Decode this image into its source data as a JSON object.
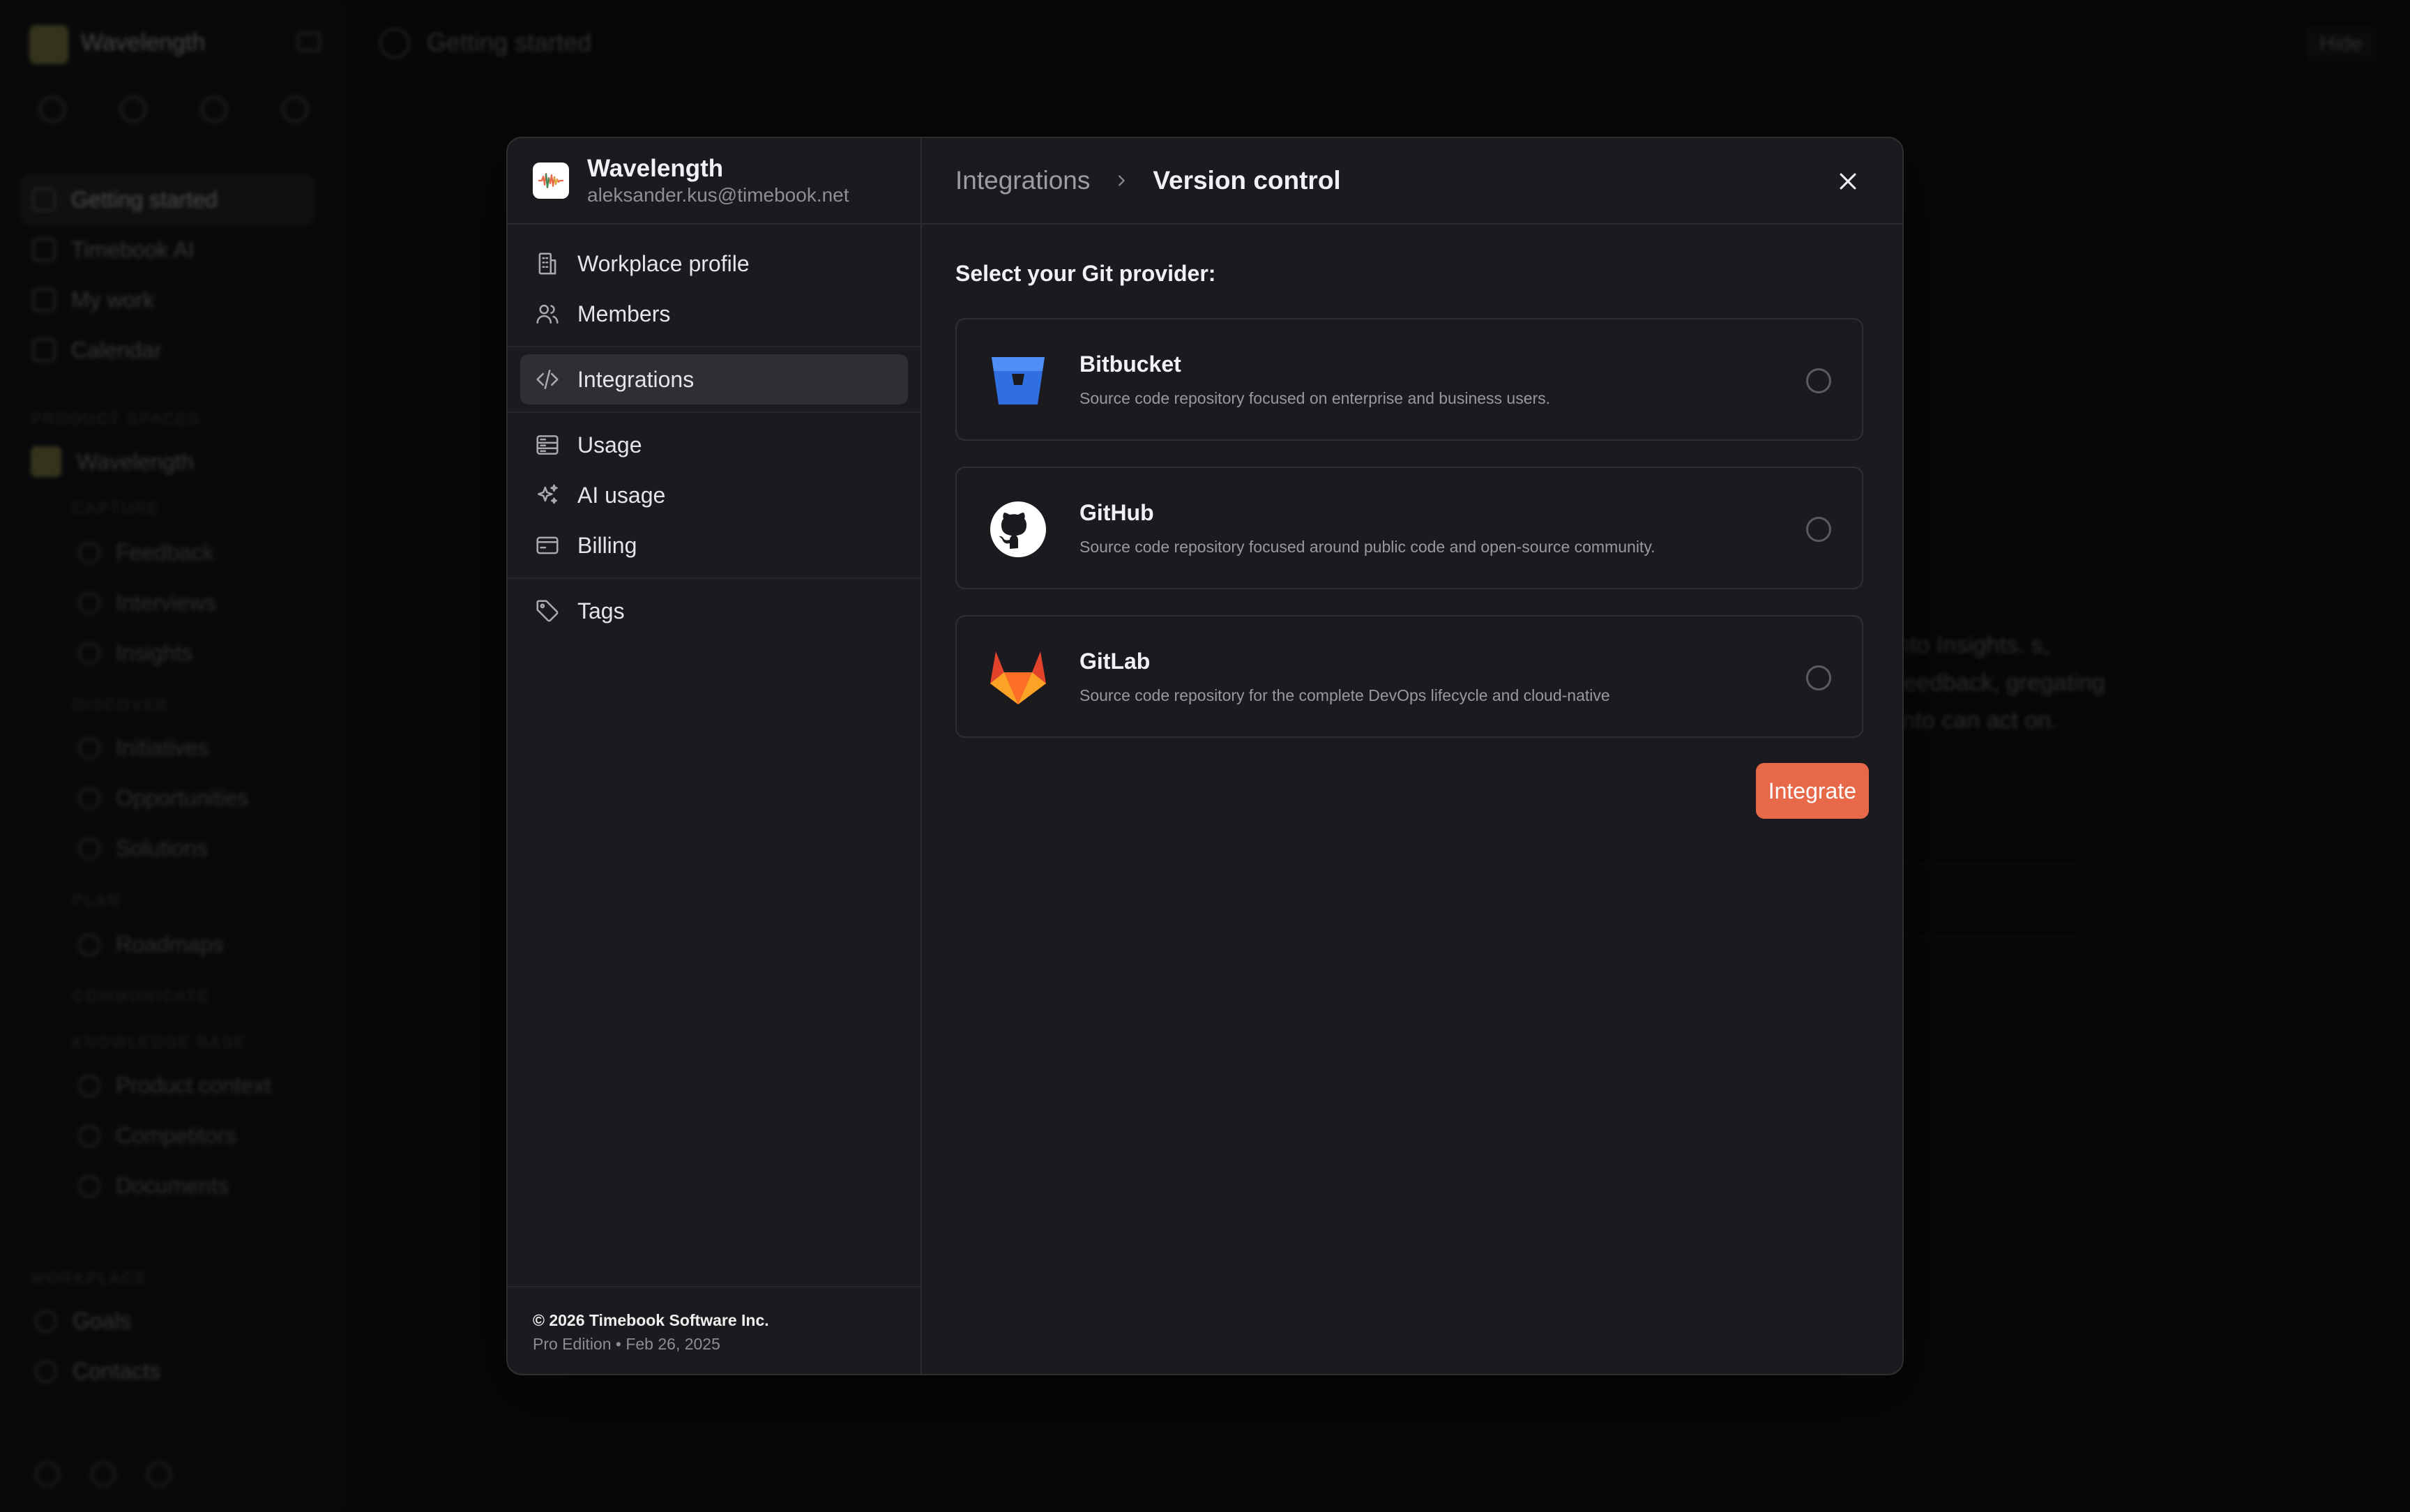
{
  "background": {
    "workspace_name": "Wavelength",
    "page_title": "Getting started",
    "hide_label": "Hide",
    "nav": [
      "Getting started",
      "Timebook AI",
      "My work",
      "Calendar"
    ],
    "section_product": "PRODUCT SPACES",
    "space_name": "Wavelength",
    "sub_capture": "CAPTURE",
    "capture_items": [
      "Feedback",
      "Interviews",
      "Insights"
    ],
    "sub_discover": "DISCOVER",
    "discover_items": [
      "Initiatives",
      "Opportunities",
      "Solutions"
    ],
    "sub_plan": "PLAN",
    "plan_items": [
      "Roadmaps"
    ],
    "sub_communicate": "COMMUNICATE",
    "sub_knowledge": "KNOWLEDGE BASE",
    "knowledge_items": [
      "Product context",
      "Competitors",
      "Documents"
    ],
    "section_workplace": "WORKPLACE",
    "workplace_items": [
      "Goals",
      "Contacts"
    ],
    "body_text": "nto Insights. s, feedback, gregating into can act on."
  },
  "modal": {
    "workspace": {
      "name": "Wavelength",
      "email": "aleksander.kus@timebook.net"
    },
    "nav": {
      "workplace_profile": "Workplace profile",
      "members": "Members",
      "integrations": "Integrations",
      "usage": "Usage",
      "ai_usage": "AI usage",
      "billing": "Billing",
      "tags": "Tags"
    },
    "footer": {
      "copyright": "© 2026 Timebook Software Inc.",
      "edition": "Pro Edition • Feb 26, 2025"
    },
    "breadcrumb": {
      "parent": "Integrations",
      "current": "Version control"
    },
    "select_label": "Select your Git provider:",
    "providers": [
      {
        "name": "Bitbucket",
        "description": "Source code repository focused on enterprise and business users.",
        "icon": "bitbucket-icon",
        "color": "#2f6fe0",
        "selected": false
      },
      {
        "name": "GitHub",
        "description": "Source code repository focused around public code and open-source community.",
        "icon": "github-icon",
        "color": "#ffffff",
        "selected": false
      },
      {
        "name": "GitLab",
        "description": "Source code repository for the complete DevOps lifecycle and cloud-native",
        "icon": "gitlab-icon",
        "color": "#e2432a",
        "selected": false
      }
    ],
    "integrate_label": "Integrate",
    "accent_color": "#e8694a"
  }
}
